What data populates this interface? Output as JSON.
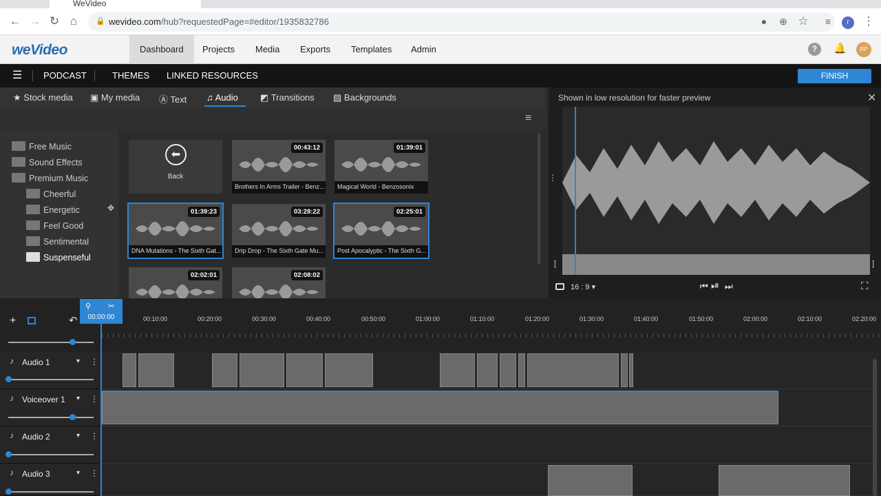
{
  "browser": {
    "tab_title": "WeVideo",
    "url_host": "wevideo.com",
    "url_path": "/hub?requestedPage=#editor/1935832786",
    "profile_initial": "r"
  },
  "header": {
    "logo": "weVideo",
    "nav": [
      "Dashboard",
      "Projects",
      "Media",
      "Exports",
      "Templates",
      "Admin"
    ],
    "avatar": "RP"
  },
  "editor_bar": {
    "podcast": "PODCAST",
    "themes": "THEMES",
    "linked": "LINKED RESOURCES",
    "finish": "FINISH"
  },
  "media_tabs": [
    "Stock media",
    "My media",
    "Text",
    "Audio",
    "Transitions",
    "Backgrounds"
  ],
  "folders": [
    "Free Music",
    "Sound Effects",
    "Premium Music",
    "Cheerful",
    "Energetic",
    "Feel Good",
    "Sentimental",
    "Suspenseful"
  ],
  "back_label": "Back",
  "cards": [
    {
      "title": "Brothers In Arms Trailer - Benz...",
      "duration": "00:43:12"
    },
    {
      "title": "Magical World - Benzosonix",
      "duration": "01:39:01"
    },
    {
      "title": "DNA Mutations - The Sixth Gat...",
      "duration": "01:39:23"
    },
    {
      "title": "Drip Drop - The Sixth Gate Mu...",
      "duration": "03:28:22"
    },
    {
      "title": "Post Apocalyptic - The Sixth G...",
      "duration": "02:25:01"
    },
    {
      "title": "",
      "duration": "02:02:01"
    },
    {
      "title": "",
      "duration": "02:08:02"
    }
  ],
  "preview": {
    "notice": "Shown in low resolution for faster preview",
    "aspect": "16 : 9"
  },
  "timeline": {
    "playhead_time": "00:00:00",
    "ticks": [
      "00:10:00",
      "00:20:00",
      "00:30:00",
      "00:40:00",
      "00:50:00",
      "01:00:00",
      "01:10:00",
      "01:20:00",
      "01:30:00",
      "01:40:00",
      "01:50:00",
      "02:00:00",
      "02:10:00",
      "02:20:00"
    ],
    "tracks": [
      "Audio 1",
      "Voiceover 1",
      "Audio 2",
      "Audio 3"
    ]
  },
  "colors": {
    "accent": "#2f86d4"
  }
}
